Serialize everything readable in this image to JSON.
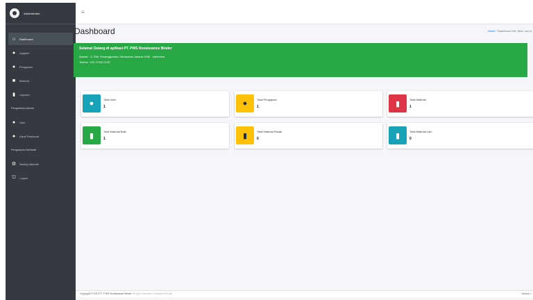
{
  "brand": {
    "name": "Administrator"
  },
  "sidebar": {
    "items": [
      {
        "label": "Dashboard",
        "icon": "home-icon"
      },
      {
        "label": "Supplier",
        "icon": "user-icon"
      },
      {
        "label": "Pengajuan",
        "icon": "globe-icon"
      },
      {
        "label": "Material",
        "icon": "box-icon"
      },
      {
        "label": "Laporan",
        "icon": "file-icon"
      }
    ],
    "header_1": "Pengaturan Admin",
    "items_2": [
      {
        "label": "User",
        "icon": "user-icon"
      },
      {
        "label": "Ganti Password",
        "icon": "user-icon"
      }
    ],
    "header_2": "Pengaturan Website",
    "items_3": [
      {
        "label": "Setting Website",
        "icon": "gear-icon"
      },
      {
        "label": "Logout",
        "icon": "logout-icon"
      }
    ]
  },
  "page": {
    "title": "Dashboard",
    "breadcrumb_home": "Home",
    "breadcrumb_rest": " / Dashboard Hai, Mas. ulul ul"
  },
  "alert": {
    "title": "Selamat Datang di aplikasi PT. PWS Renaissance Binder",
    "address": "Alamat : Jl. 23A, Pesanggrahan, Kebayoran Jakarta 1000 - Indonesia",
    "phone": "Telefon : 021 27921 0707"
  },
  "cards": [
    {
      "label": "Total User",
      "value": "1",
      "color": "#17a2b8",
      "icon": "users-icon"
    },
    {
      "label": "Total Pengajuan",
      "value": "1",
      "color": "#ffc107",
      "icon": "people-icon"
    },
    {
      "label": "Total Material",
      "value": "1",
      "color": "#dc3545",
      "icon": "book-icon"
    },
    {
      "label": "Total Material Baik",
      "value": "1",
      "color": "#28a745",
      "icon": "book-icon"
    },
    {
      "label": "Total Material Rusak",
      "value": "0",
      "color": "#ffc107",
      "icon": "book-icon"
    },
    {
      "label": "Total Material Lain",
      "value": "0",
      "color": "#17a2b8",
      "icon": "book-icon"
    }
  ],
  "footer": {
    "copyright": "Copyright © 2021 PT. PWS Renaissance Binder",
    "rights": " All rights reserved. Developed by ulul",
    "version": "Version 1"
  }
}
